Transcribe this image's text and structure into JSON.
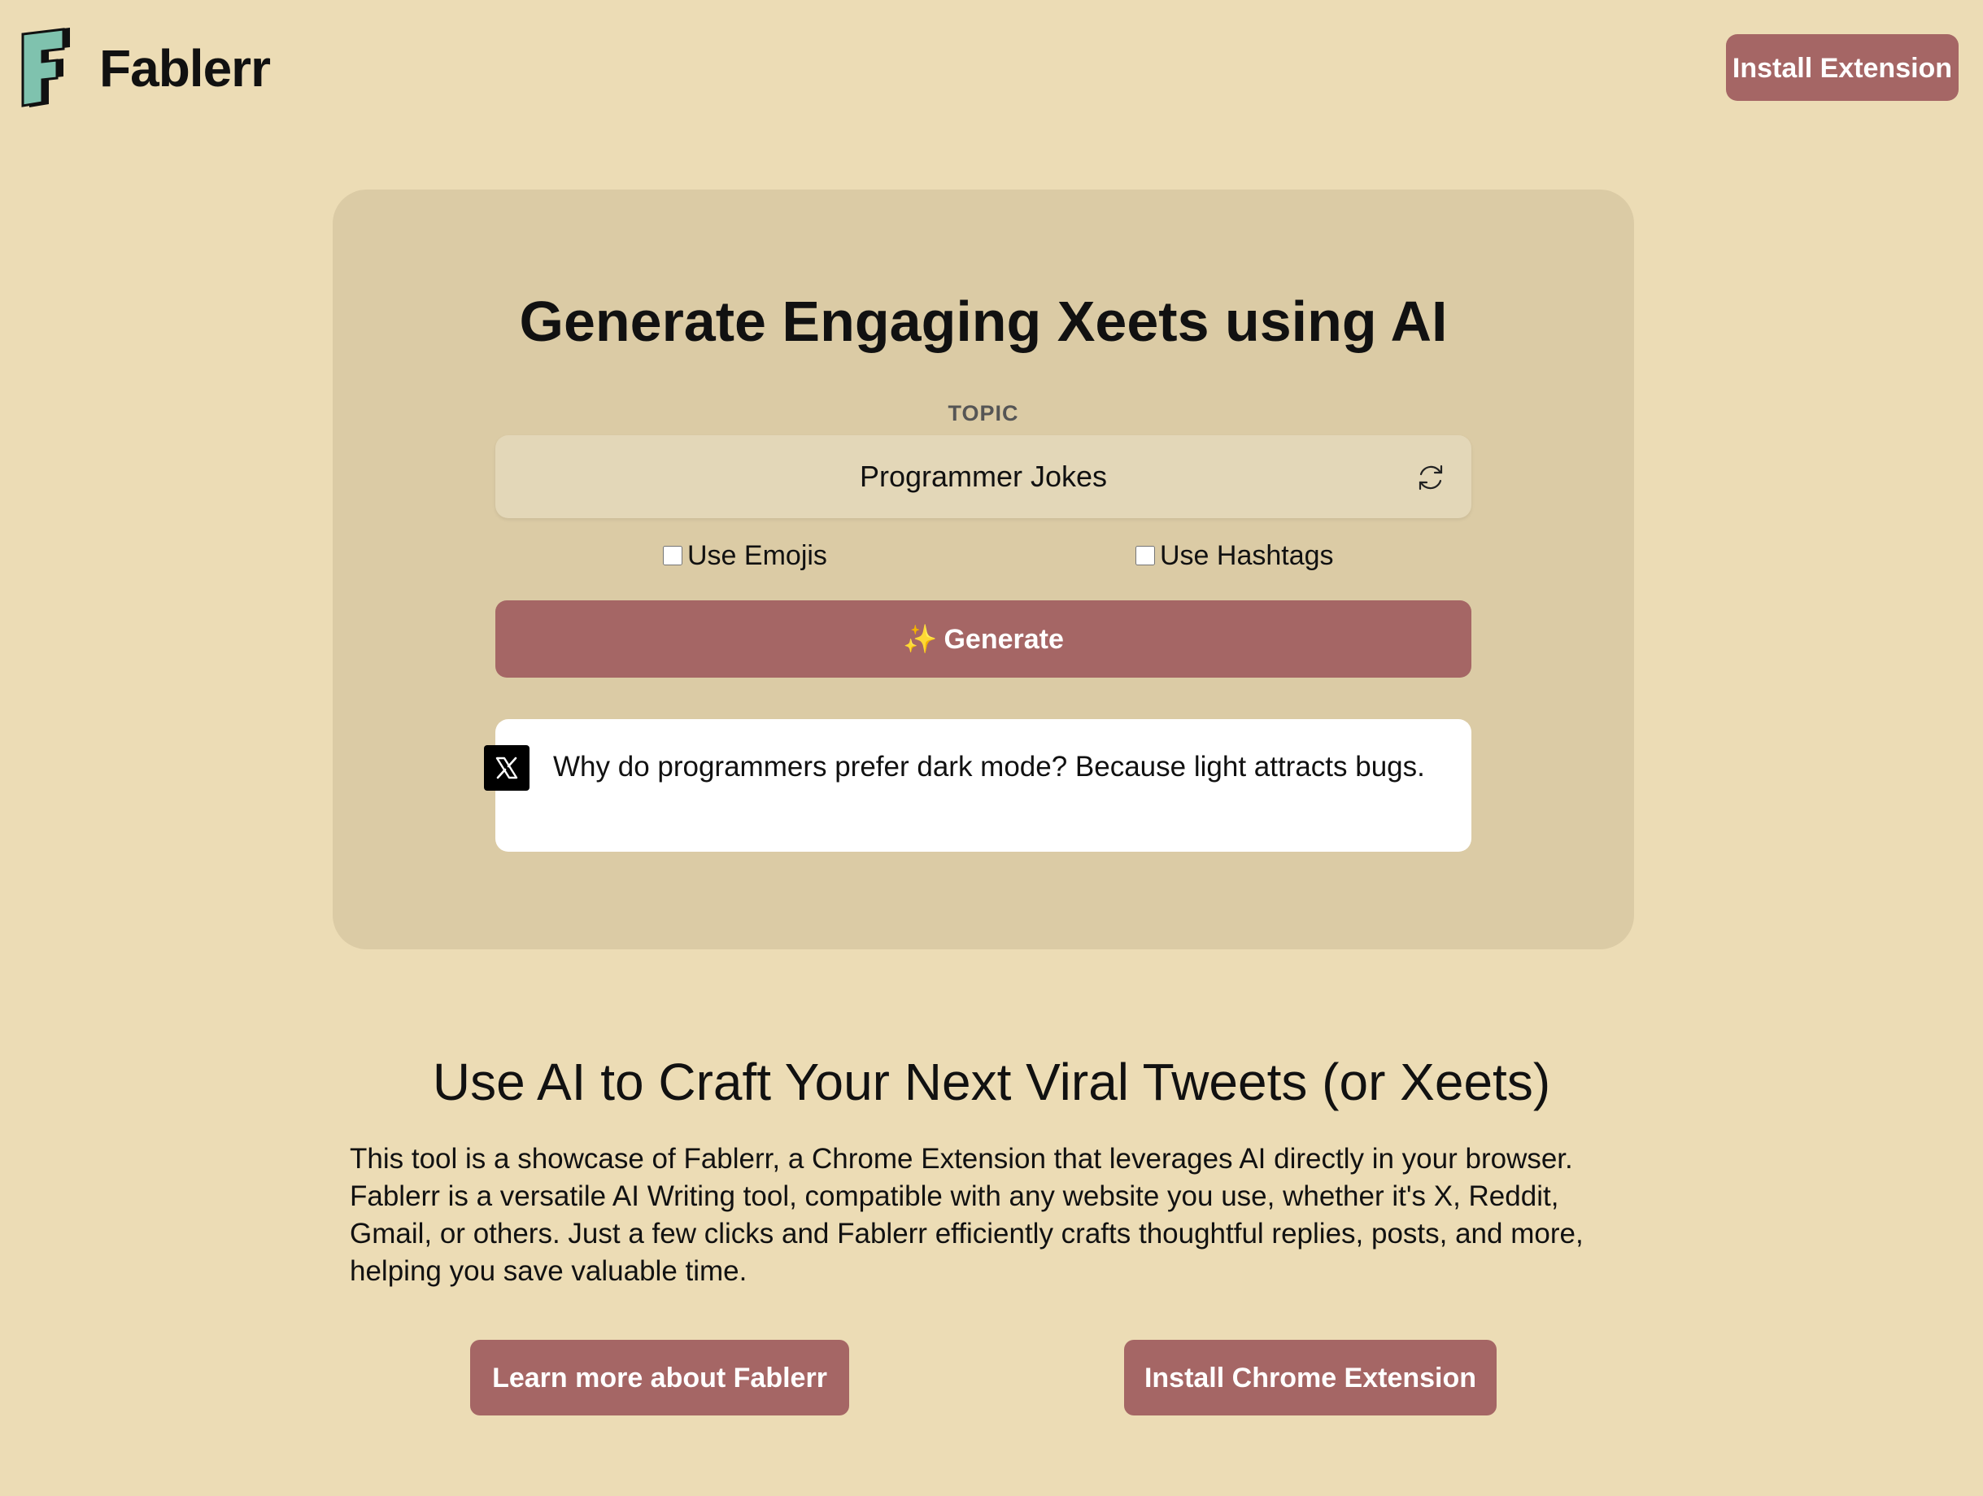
{
  "header": {
    "brand_name": "Fablerr",
    "install_label": "Install Extension"
  },
  "generator": {
    "title": "Generate Engaging Xeets using AI",
    "topic_label": "TOPIC",
    "topic_value": "Programmer Jokes",
    "use_emojis_label": "Use Emojis",
    "use_hashtags_label": "Use Hashtags",
    "use_emojis_checked": false,
    "use_hashtags_checked": false,
    "generate_sparkle": "✨",
    "generate_label": "Generate",
    "result_text": "Why do programmers prefer dark mode? Because light attracts bugs."
  },
  "about": {
    "title": "Use AI to Craft Your Next Viral Tweets (or Xeets)",
    "body": "This tool is a showcase of Fablerr, a Chrome Extension that leverages AI directly in your browser. Fablerr is a versatile AI Writing tool, compatible with any website you use, whether it's X, Reddit, Gmail, or others. Just a few clicks and Fablerr efficiently crafts thoughtful replies, posts, and more, helping you save valuable time.",
    "learn_more_label": "Learn more about Fablerr",
    "install_chrome_label": "Install Chrome Extension"
  },
  "icons": {
    "logo": "fablerr-logo-icon",
    "refresh": "refresh-icon",
    "x": "x-logo-icon"
  },
  "colors": {
    "background": "#ecdcb5",
    "card": "#dbcba5",
    "accent": "#a56665",
    "logo_teal": "#7fc2ae"
  }
}
